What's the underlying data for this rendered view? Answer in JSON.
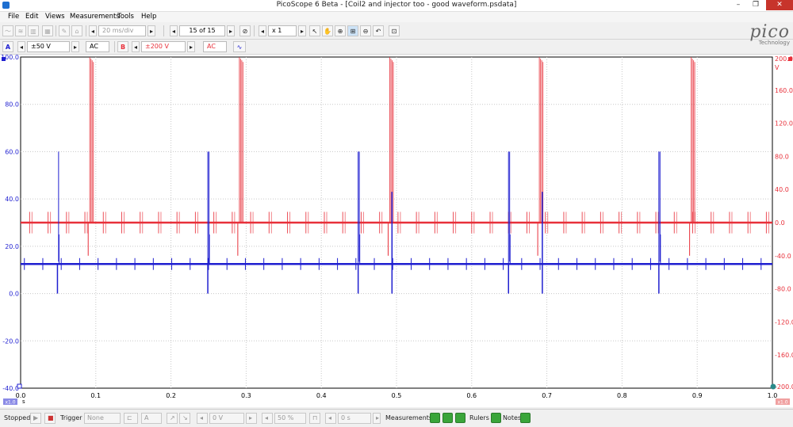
{
  "window": {
    "title": "PicoScope 6 Beta - [Coil2 and injector too - good waveform.psdata]",
    "controls": [
      "–",
      "❐",
      "✕"
    ]
  },
  "menu": [
    "File",
    "Edit",
    "Views",
    "Measurements",
    "Tools",
    "Help"
  ],
  "toolbar1": {
    "timebase": "20 ms/div",
    "page": "15 of 15",
    "zoom": "x 1"
  },
  "toolbar2": {
    "chA": {
      "label": "A",
      "range": "±50 V",
      "coupling": "AC",
      "color": "#1f1fd0"
    },
    "chB": {
      "label": "B",
      "range": "±200 V",
      "coupling": "AC",
      "color": "#e8303a"
    }
  },
  "logo": {
    "name": "pico",
    "sub": "Technology"
  },
  "chart_data": {
    "type": "line",
    "x_ticks": [
      "0.0",
      "0.1",
      "0.2",
      "0.3",
      "0.4",
      "0.5",
      "0.6",
      "0.7",
      "0.8",
      "0.9",
      "1.0"
    ],
    "x_unit": "s",
    "left_axis": {
      "unit": "V",
      "ticks": [
        "100.0",
        "80.0",
        "60.0",
        "40.0",
        "20.0",
        "0.0",
        "-20.0",
        "-40.0"
      ],
      "ylim": [
        -40,
        100
      ],
      "color": "#1f1fd0"
    },
    "right_axis": {
      "unit": "V",
      "ticks": [
        "200.0",
        "160.0",
        "120.0",
        "80.0",
        "40.0",
        "0.0",
        "-40.0",
        "-80.0",
        "-120.0",
        "-160.0",
        "-200.0"
      ],
      "ylim": [
        -200,
        200
      ],
      "color": "#e8303a"
    },
    "series": [
      {
        "channel": "A",
        "color": "#1f1fd0",
        "baseline": 12.5,
        "large_spikes_x": [
          0.049,
          0.249,
          0.449,
          0.649,
          0.849
        ],
        "large_spike_peak": 60,
        "large_spike_low": 0,
        "mid_spikes_x": [
          0.494,
          0.694
        ],
        "mid_spike_peak": 43,
        "small_pulse_interval": 0.0245
      },
      {
        "channel": "B",
        "color": "#e8303a",
        "baseline": 0,
        "large_spikes_x": [
          0.092,
          0.291,
          0.491,
          0.69,
          0.892
        ],
        "large_spike_peak": 200,
        "large_spike_low": -40,
        "small_pulse_interval": 0.0245,
        "small_pulse_amp": 13
      }
    ],
    "grid": true,
    "channel_tags": {
      "left": "x1.0",
      "right": "x1.0"
    }
  },
  "status": {
    "state": "Stopped",
    "trigger_label": "Trigger",
    "trigger_mode": "None",
    "trigger_channel": "A",
    "threshold": "0 V",
    "percent": "50 %",
    "delay": "0 s",
    "measurements": "Measurements",
    "rulers": "Rulers",
    "notes": "Notes"
  }
}
